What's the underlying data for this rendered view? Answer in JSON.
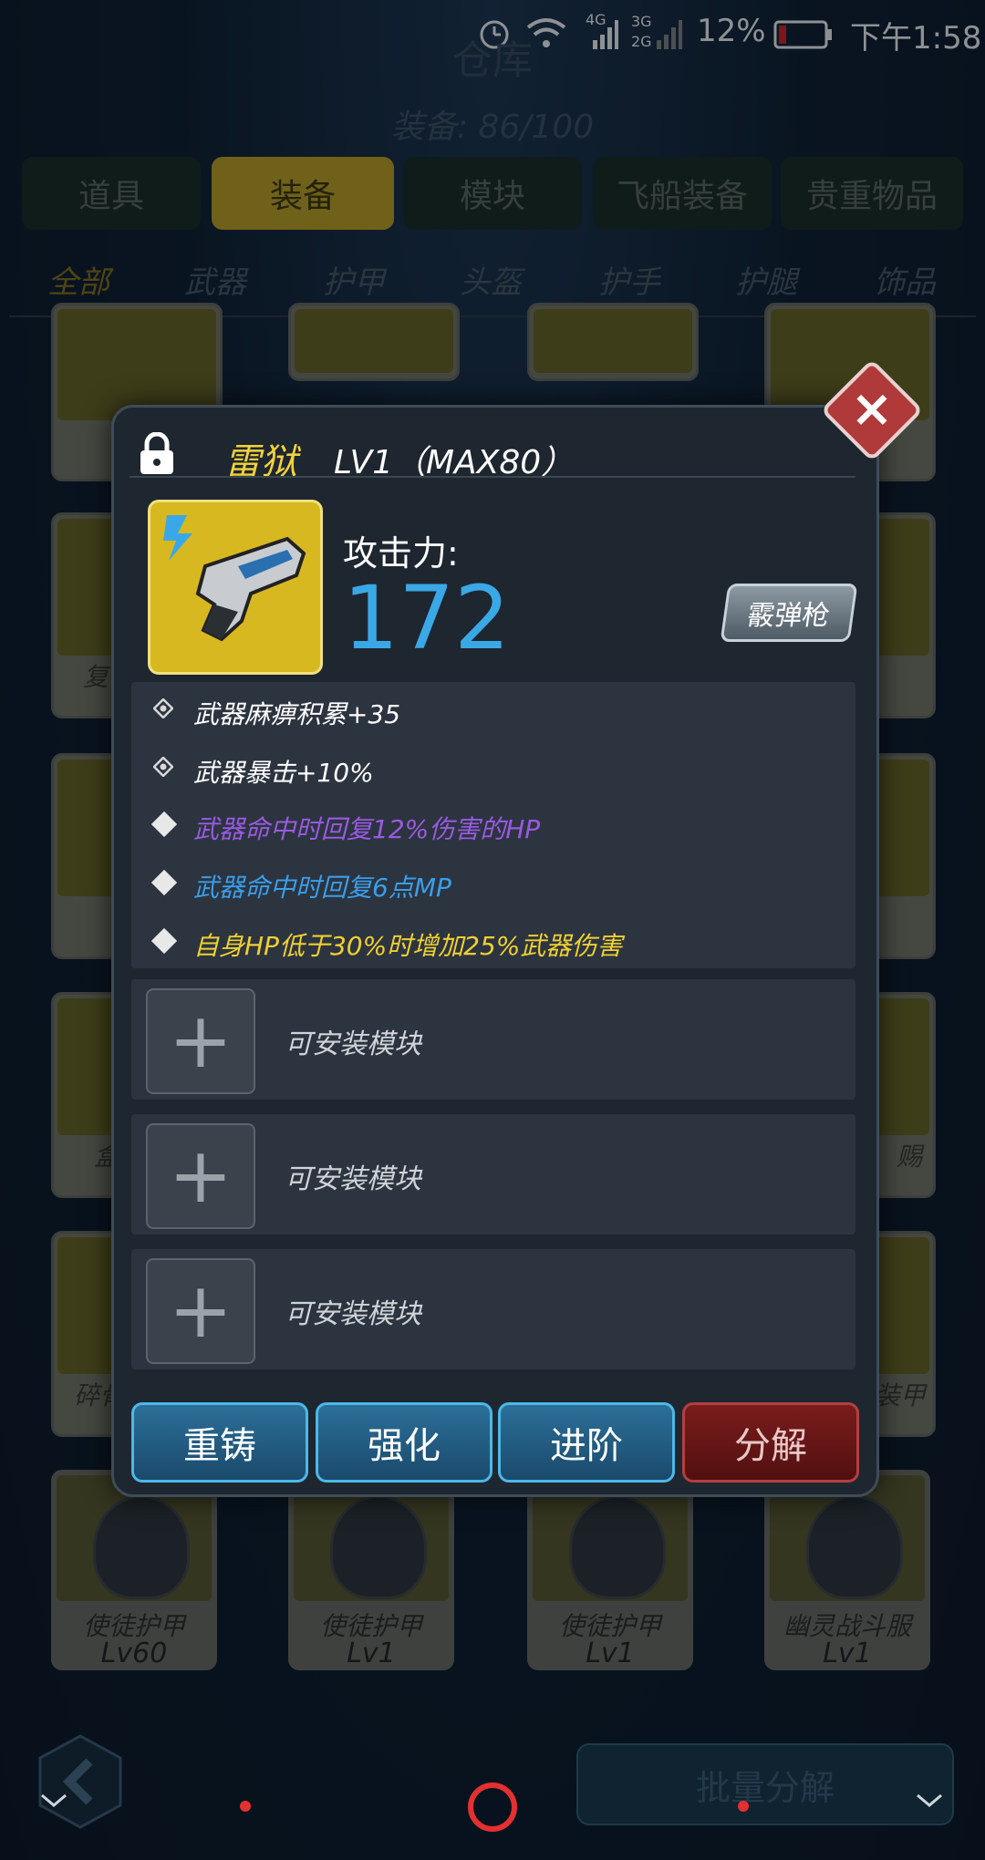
{
  "status_bar": {
    "battery": "12%",
    "time": "下午1:58",
    "net_4g": "4G",
    "net_3g": "3G",
    "net_2g": "2G"
  },
  "page": {
    "title": "仓库",
    "equip_count": "装备: 86/100"
  },
  "tabs": [
    {
      "label": "道具",
      "active": false
    },
    {
      "label": "装备",
      "active": true
    },
    {
      "label": "模块",
      "active": false
    },
    {
      "label": "飞船装备",
      "active": false
    },
    {
      "label": "贵重物品",
      "active": false
    }
  ],
  "subtabs": [
    {
      "label": "全部",
      "active": true
    },
    {
      "label": "武器",
      "active": false
    },
    {
      "label": "护甲",
      "active": false
    },
    {
      "label": "头盔",
      "active": false
    },
    {
      "label": "护手",
      "active": false
    },
    {
      "label": "护腿",
      "active": false
    },
    {
      "label": "饰品",
      "active": false
    }
  ],
  "grid_fragments": {
    "r2_left": "复",
    "r4_left": "盒",
    "r4_right": "赐",
    "r5_left": "碎骨",
    "r5_right": "装甲"
  },
  "bottom_cards": [
    {
      "name": "使徒护甲",
      "level": "Lv60"
    },
    {
      "name": "使徒护甲",
      "level": "Lv1"
    },
    {
      "name": "使徒护甲",
      "level": "Lv1"
    },
    {
      "name": "幽灵战斗服",
      "level": "Lv1"
    }
  ],
  "item": {
    "name": "雷狱",
    "level": "LV1（MAX80）",
    "attack_label": "攻击力:",
    "attack_value": "172",
    "type": "霰弹枪",
    "stats": [
      {
        "text": "武器麻痹积累+35",
        "color": "#ffffff",
        "icon": "gear-diamond-icon"
      },
      {
        "text": "武器暴击+10%",
        "color": "#ffffff",
        "icon": "gear-diamond-icon"
      },
      {
        "text": "武器命中时回复12%伤害的HP",
        "color": "#9a5ae0",
        "icon": "diamond-icon"
      },
      {
        "text": "武器命中时回复6点MP",
        "color": "#3a9ee8",
        "icon": "diamond-icon"
      },
      {
        "text": "自身HP低于30%时增加25%武器伤害",
        "color": "#f0d030",
        "icon": "diamond-icon"
      }
    ],
    "module_slots": [
      {
        "label": "可安装模块"
      },
      {
        "label": "可安装模块"
      },
      {
        "label": "可安装模块"
      }
    ]
  },
  "actions": {
    "reforge": "重铸",
    "enhance": "强化",
    "advance": "进阶",
    "decompose": "分解"
  },
  "bottom": {
    "batch_decompose": "批量分解"
  }
}
